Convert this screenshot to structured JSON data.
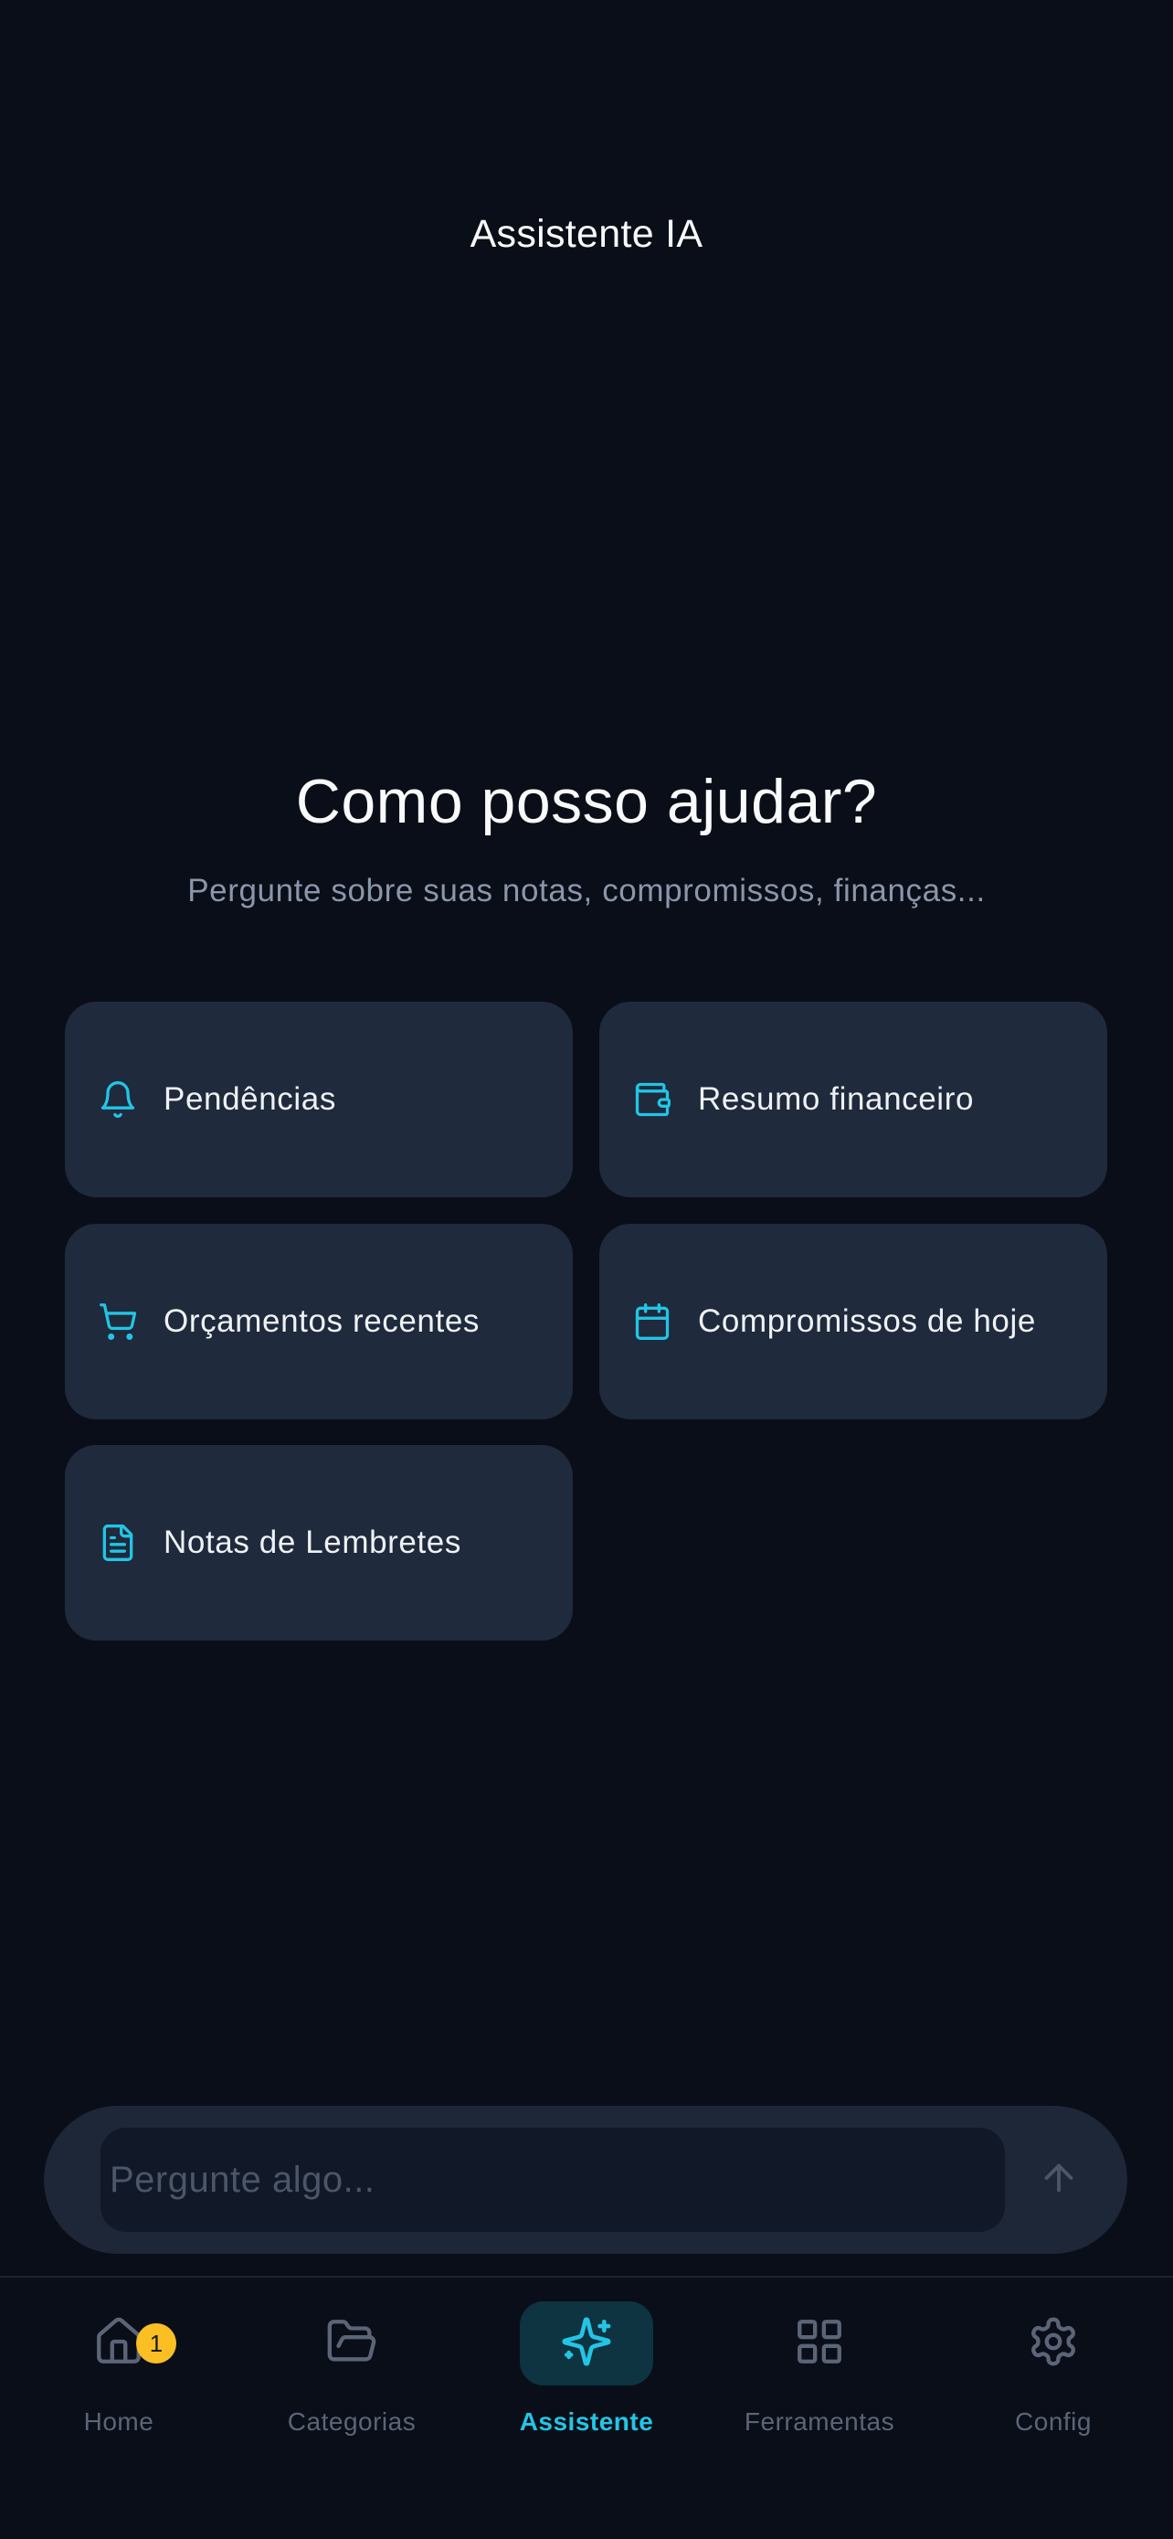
{
  "header": {
    "title": "Assistente IA"
  },
  "hero": {
    "title": "Como posso ajudar?",
    "subtitle": "Pergunte sobre suas notas, compromissos, finanças..."
  },
  "suggestions": [
    {
      "label": "Pendências",
      "icon": "bell-icon"
    },
    {
      "label": "Resumo financeiro",
      "icon": "wallet-icon"
    },
    {
      "label": "Orçamentos recentes",
      "icon": "cart-icon"
    },
    {
      "label": "Compromissos de hoje",
      "icon": "calendar-icon"
    },
    {
      "label": "Notas de Lembretes",
      "icon": "document-icon"
    }
  ],
  "composer": {
    "placeholder": "Pergunte algo...",
    "value": "",
    "send_icon": "arrow-up-icon"
  },
  "nav": {
    "items": [
      {
        "label": "Home",
        "icon": "home-icon",
        "badge": "1"
      },
      {
        "label": "Categorias",
        "icon": "folder-open-icon"
      },
      {
        "label": "Assistente",
        "icon": "sparkles-icon",
        "active": true
      },
      {
        "label": "Ferramentas",
        "icon": "grid-icon"
      },
      {
        "label": "Config",
        "icon": "gear-icon"
      }
    ]
  },
  "colors": {
    "background": "#0a0e18",
    "card": "#1f2a3c",
    "accent": "#22c5e6",
    "muted": "#5b6577",
    "badge": "#fbbf24"
  }
}
